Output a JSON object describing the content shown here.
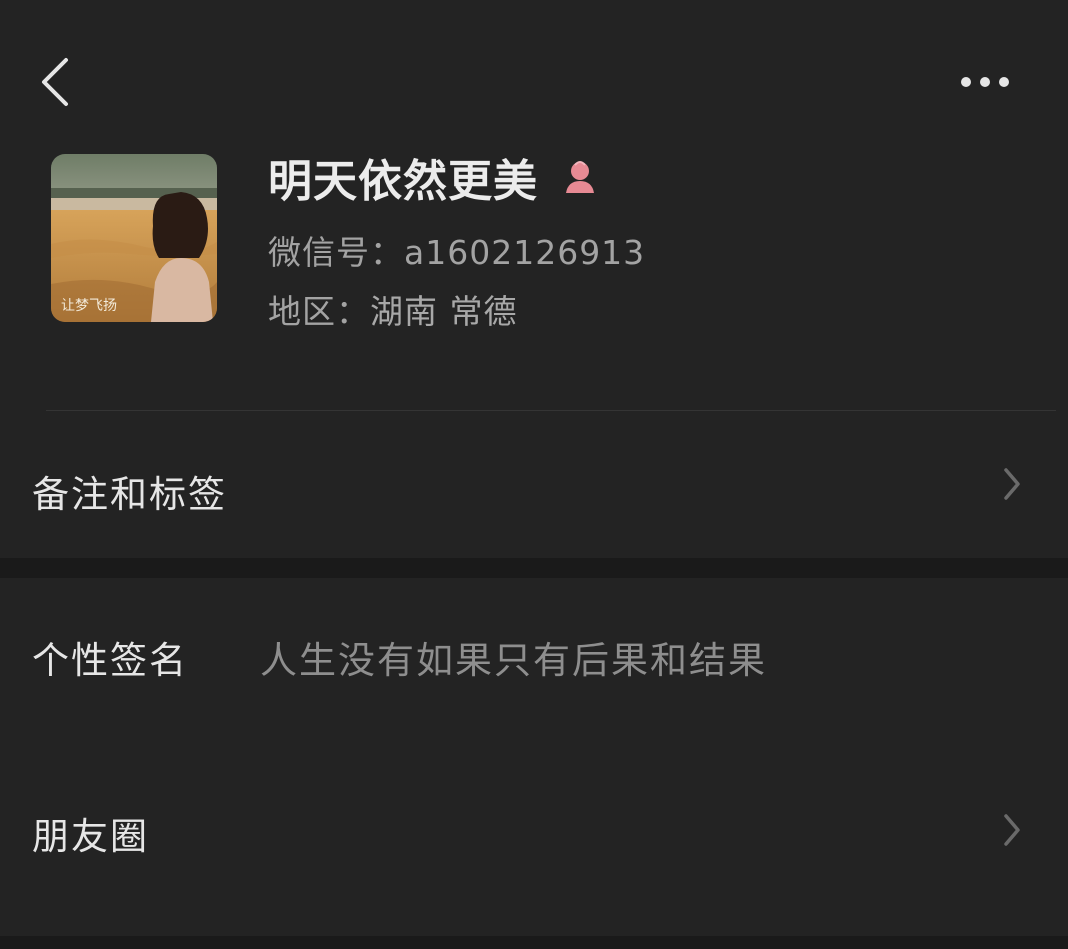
{
  "header": {
    "back_icon": "chevron-left-icon",
    "more_icon": "ellipsis-icon"
  },
  "profile": {
    "nickname": "明天依然更美",
    "gender_icon": "female-icon",
    "gender_color": "#e78a94",
    "wechat_id_label": "微信号：",
    "wechat_id": "a1602126913",
    "region_label": "地区：",
    "region": "湖南 常德",
    "avatar_caption": "让梦飞扬"
  },
  "menu": {
    "tags_label": "备注和标签",
    "signature_label": "个性签名",
    "signature_value": "人生没有如果只有后果和结果",
    "moments_label": "朋友圈"
  },
  "colors": {
    "background": "#232323",
    "separator_band": "#1a1a1a",
    "primary_text": "#e8e8e8",
    "secondary_text": "#a3a3a3"
  }
}
